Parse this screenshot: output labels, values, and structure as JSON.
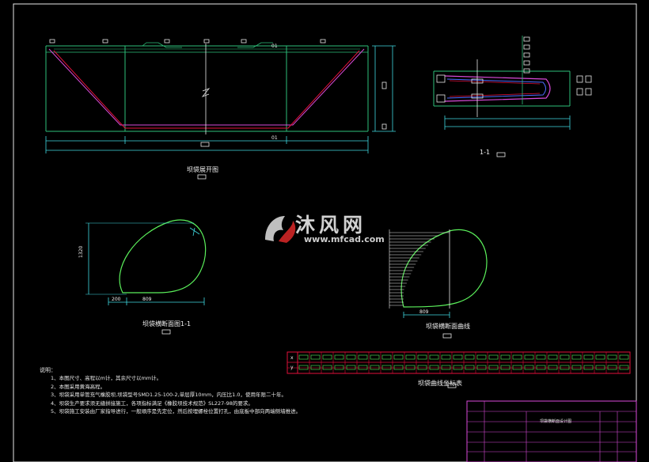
{
  "views": {
    "plan_title": "坝袋展开图",
    "section_title": "1-1",
    "cross_section_title": "坝袋横断面图1-1",
    "curve_title": "坝袋横断面曲线",
    "coord_table_title": "坝袋曲线坐标表"
  },
  "plan_labels": {
    "top_mark": "01",
    "bottom_mark": "01"
  },
  "cross_section_dims": {
    "height": "1320",
    "left_width": "200",
    "right_width": "809"
  },
  "curve_dims": {
    "width": "809"
  },
  "coord_table": {
    "row_labels": [
      "x",
      "y"
    ],
    "column_count": 28
  },
  "notes": {
    "heading": "说明：",
    "items": [
      "1、本图尺寸、高程以m计，其余尺寸以mm计。",
      "2、本图采用黄海高程。",
      "3、坝袋采用单管充气橡胶坝,坝袋型号SMD1.25-100-2,单层厚10mm，内压比1.0，使用年限二十年。",
      "4、坝袋生产要求须无缝拼接施工，各项指标满足《橡胶坝技术规范》SL227-98的要求。",
      "5、坝袋施工安装由厂家指导进行，一般顺序是先定位，然后按埋螺栓位置打孔，由底板中部向两端侧墙推进。"
    ]
  },
  "title_block": {
    "drawing_name": "坝袋横断面设计图"
  },
  "watermark": {
    "brand": "沐风网",
    "url": "www.mfcad.com"
  },
  "colors": {
    "background": "#000000",
    "outline": "#2ec07a",
    "dimension": "#3fd9e0",
    "red_line": "#e0103a",
    "magenta": "#d84ad8",
    "blue": "#4d6bff",
    "curve": "#5bf05b",
    "white": "#e8e8e8"
  }
}
